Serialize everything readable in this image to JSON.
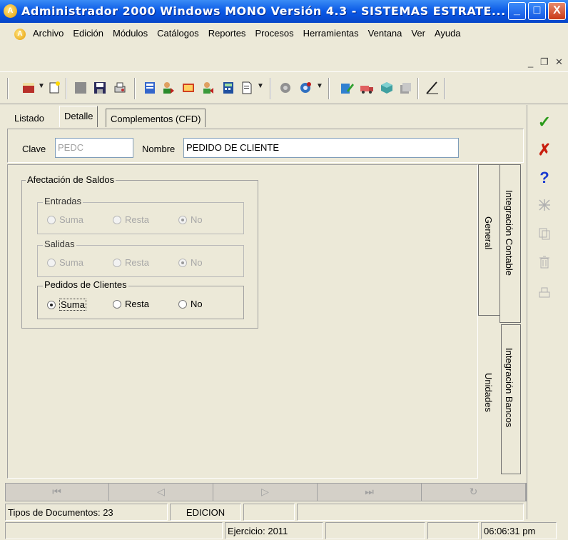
{
  "window": {
    "title": "Administrador 2000 Windows MONO Versión 4.3 - SISTEMAS ESTRATE...",
    "app_icon_letter": "A",
    "buttons": {
      "minimize": "_",
      "maximize": "□",
      "close": "X"
    }
  },
  "menu": {
    "items": [
      "Archivo",
      "Edición",
      "Módulos",
      "Catálogos",
      "Reportes",
      "Procesos",
      "Herramientas",
      "Ventana",
      "Ver",
      "Ayuda"
    ],
    "mdi_controls": {
      "minimize": "_",
      "restore": "❐",
      "close": "✕"
    }
  },
  "toolbar": {
    "icons": [
      "new-record-icon",
      "new-document-icon",
      "blank-icon",
      "save-icon",
      "print-preview-icon",
      "catalog-icon",
      "customers-icon",
      "transfer-icon",
      "suppliers-icon",
      "calculator-icon",
      "report-icon",
      "settings-icon",
      "gear-icon",
      "edit-icon",
      "truck-icon",
      "package-icon",
      "stack-icon",
      "ruler-icon"
    ]
  },
  "tabs": {
    "listado": "Listado",
    "detalle": "Detalle",
    "complementos": "Complementos (CFD)"
  },
  "form": {
    "clave_label": "Clave",
    "clave_value": "PEDC",
    "nombre_label": "Nombre",
    "nombre_value": "PEDIDO DE CLIENTE"
  },
  "afectacion": {
    "title": "Afectación de Saldos",
    "entradas": {
      "title": "Entradas",
      "options": [
        "Suma",
        "Resta",
        "No"
      ],
      "selected": "No",
      "enabled": false
    },
    "salidas": {
      "title": "Salidas",
      "options": [
        "Suma",
        "Resta",
        "No"
      ],
      "selected": "No",
      "enabled": false
    },
    "pedidos": {
      "title": "Pedidos de Clientes",
      "options": [
        "Suma",
        "Resta",
        "No"
      ],
      "selected": "Suma",
      "enabled": true
    }
  },
  "side_tabs": {
    "general": "General",
    "integracion_contable": "Integración Contable",
    "unidades": "Unidades",
    "integracion_bancos": "Integración Bancos"
  },
  "right_buttons": {
    "accept": "✓",
    "cancel": "✗",
    "help": "?"
  },
  "navigation": {
    "first": "⏮",
    "prev": "◁",
    "next": "▷",
    "last": "⏭",
    "refresh": "↻"
  },
  "status": {
    "record_info": "Tipos de Documentos: 23",
    "mode": "EDICION",
    "ejercicio": "Ejercicio: 2011",
    "time": "06:06:31 pm"
  },
  "colors": {
    "titlebar": "#0958e6",
    "accept": "#2a9a1a",
    "cancel": "#c81e0e",
    "help": "#1a3ad0"
  }
}
